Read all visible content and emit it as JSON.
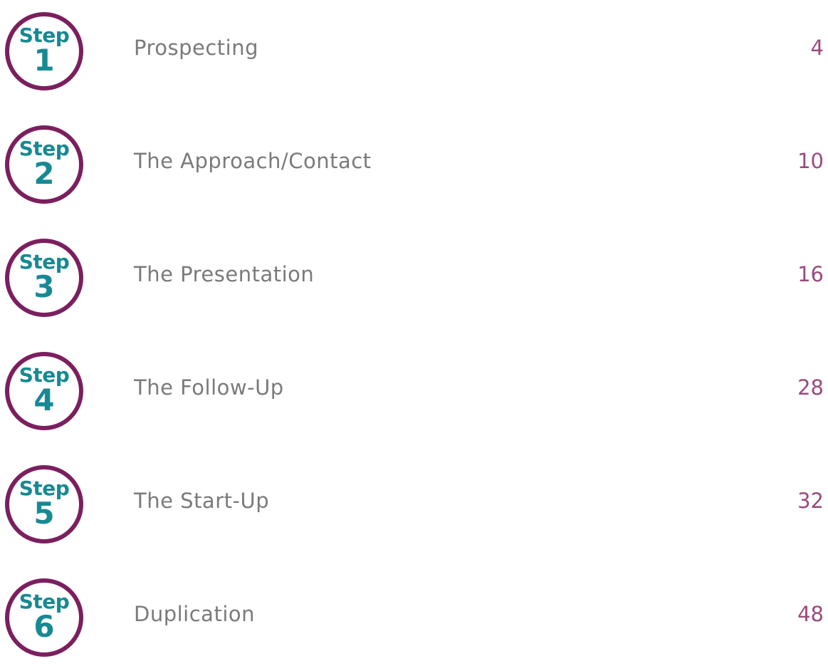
{
  "toc": {
    "items": [
      {
        "step_label": "Step",
        "number": "1",
        "title": "Prospecting",
        "page": "4"
      },
      {
        "step_label": "Step",
        "number": "2",
        "title": "The Approach/Contact",
        "page": "10"
      },
      {
        "step_label": "Step",
        "number": "3",
        "title": "The Presentation",
        "page": "16"
      },
      {
        "step_label": "Step",
        "number": "4",
        "title": "The Follow-Up",
        "page": "28"
      },
      {
        "step_label": "Step",
        "number": "5",
        "title": "The Start-Up",
        "page": "32"
      },
      {
        "step_label": "Step",
        "number": "6",
        "title": "Duplication",
        "page": "48"
      }
    ]
  },
  "colors": {
    "badge_ring": "#7b1f5e",
    "badge_text": "#168a93",
    "title_text": "#7a7a7a",
    "page_number": "#9a4a7e"
  }
}
